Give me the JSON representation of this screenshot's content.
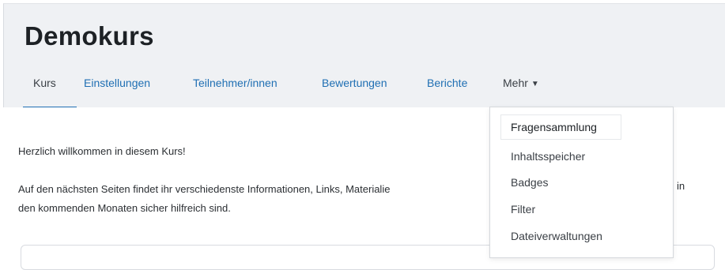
{
  "course": {
    "title": "Demokurs"
  },
  "nav": {
    "tabs": [
      {
        "label": "Kurs"
      },
      {
        "label": "Einstellungen"
      },
      {
        "label": "Teilnehmer/innen"
      },
      {
        "label": "Bewertungen"
      },
      {
        "label": "Berichte"
      }
    ],
    "more_label": "Mehr",
    "active_tab": "Kurs"
  },
  "dropdown": {
    "items": [
      {
        "label": "Fragensammlung"
      },
      {
        "label": "Inhaltsspeicher"
      },
      {
        "label": "Badges"
      },
      {
        "label": "Filter"
      },
      {
        "label": "Dateiverwaltungen"
      }
    ],
    "highlighted": "Fragensammlung"
  },
  "content": {
    "welcome": "Herzlich willkommen in diesem Kurs!",
    "paragraph_start": "Auf den nächsten Seiten findet ihr verschiedenste Informationen, Links, Materialie",
    "paragraph_end_fragment": "in",
    "paragraph_line2": "den kommenden Monaten sicher hilfreich sind."
  },
  "colors": {
    "link": "#1f6fb3",
    "header_bg": "#eff1f4",
    "text": "#2b2f33"
  }
}
